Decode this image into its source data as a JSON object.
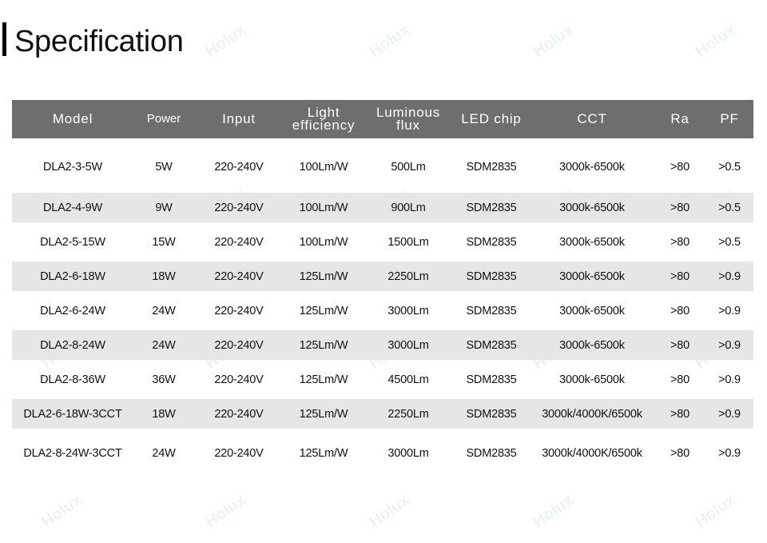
{
  "title": "Specification",
  "watermark": "Holux",
  "table": {
    "headers": [
      {
        "key": "model",
        "lines": [
          "Model"
        ]
      },
      {
        "key": "power",
        "lines": [
          "Power"
        ]
      },
      {
        "key": "input",
        "lines": [
          "Input"
        ]
      },
      {
        "key": "light_efficiency",
        "lines": [
          "Light",
          "efficiency"
        ]
      },
      {
        "key": "luminous_flux",
        "lines": [
          "Luminous",
          "flux"
        ]
      },
      {
        "key": "led_chip",
        "lines": [
          "LED chip"
        ]
      },
      {
        "key": "cct",
        "lines": [
          "CCT"
        ]
      },
      {
        "key": "ra",
        "lines": [
          "Ra"
        ]
      },
      {
        "key": "pf",
        "lines": [
          "PF"
        ]
      }
    ],
    "rows": [
      [
        "DLA2-3-5W",
        "5W",
        "220-240V",
        "100Lm/W",
        "500Lm",
        "SDM2835",
        "3000k-6500k",
        ">80",
        ">0.5"
      ],
      [
        "DLA2-4-9W",
        "9W",
        "220-240V",
        "100Lm/W",
        "900Lm",
        "SDM2835",
        "3000k-6500k",
        ">80",
        ">0.5"
      ],
      [
        "DLA2-5-15W",
        "15W",
        "220-240V",
        "100Lm/W",
        "1500Lm",
        "SDM2835",
        "3000k-6500k",
        ">80",
        ">0.5"
      ],
      [
        "DLA2-6-18W",
        "18W",
        "220-240V",
        "125Lm/W",
        "2250Lm",
        "SDM2835",
        "3000k-6500k",
        ">80",
        ">0.9"
      ],
      [
        "DLA2-6-24W",
        "24W",
        "220-240V",
        "125Lm/W",
        "3000Lm",
        "SDM2835",
        "3000k-6500k",
        ">80",
        ">0.9"
      ],
      [
        "DLA2-8-24W",
        "24W",
        "220-240V",
        "125Lm/W",
        "3000Lm",
        "SDM2835",
        "3000k-6500k",
        ">80",
        ">0.9"
      ],
      [
        "DLA2-8-36W",
        "36W",
        "220-240V",
        "125Lm/W",
        "4500Lm",
        "SDM2835",
        "3000k-6500k",
        ">80",
        ">0.9"
      ],
      [
        "DLA2-6-18W-3CCT",
        "18W",
        "220-240V",
        "125Lm/W",
        "2250Lm",
        "SDM2835",
        "3000k/4000K/6500k",
        ">80",
        ">0.9"
      ],
      [
        "DLA2-8-24W-3CCT",
        "24W",
        "220-240V",
        "125Lm/W",
        "3000Lm",
        "SDM2835",
        "3000k/4000K/6500k",
        ">80",
        ">0.9"
      ]
    ]
  },
  "colors": {
    "header_bg": "#6e6e6e",
    "header_text": "#ffffff",
    "alt_row_bg": "#e6e6e6",
    "text": "#111111",
    "accent_bar": "#000000"
  }
}
